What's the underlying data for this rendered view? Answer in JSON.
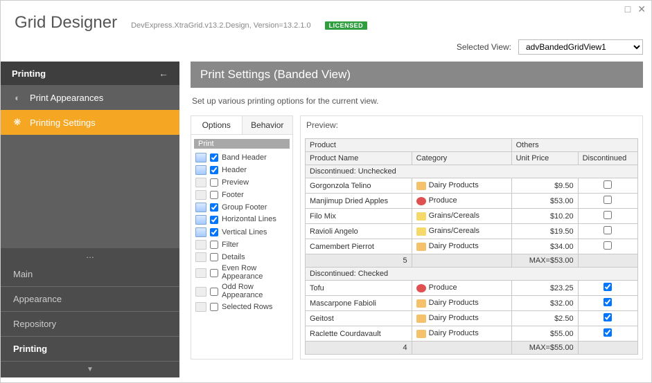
{
  "header": {
    "title": "Grid Designer",
    "subtitle": "DevExpress.XtraGrid.v13.2.Design, Version=13.2.1.0",
    "badge": "LICENSED"
  },
  "selected_view": {
    "label": "Selected View:",
    "value": "advBandedGridView1"
  },
  "sidebar": {
    "section": "Printing",
    "items": [
      {
        "label": "Print Appearances",
        "active": false
      },
      {
        "label": "Printing Settings",
        "active": true
      }
    ],
    "nav": [
      "Main",
      "Appearance",
      "Repository",
      "Printing"
    ],
    "nav_current": "Printing"
  },
  "content": {
    "title": "Print Settings (Banded View)",
    "subtitle": "Set up various printing options for the current view."
  },
  "options": {
    "tabs": [
      "Options",
      "Behavior"
    ],
    "active_tab": "Options",
    "group": "Print",
    "items": [
      {
        "label": "Band Header",
        "checked": true,
        "dim": false
      },
      {
        "label": "Header",
        "checked": true,
        "dim": false
      },
      {
        "label": "Preview",
        "checked": false,
        "dim": true
      },
      {
        "label": "Footer",
        "checked": false,
        "dim": true
      },
      {
        "label": "Group Footer",
        "checked": true,
        "dim": false
      },
      {
        "label": "Horizontal Lines",
        "checked": true,
        "dim": false
      },
      {
        "label": "Vertical Lines",
        "checked": true,
        "dim": false
      },
      {
        "label": "Filter",
        "checked": false,
        "dim": true
      },
      {
        "label": "Details",
        "checked": false,
        "dim": true
      },
      {
        "label": "Even Row Appearance",
        "checked": false,
        "dim": true
      },
      {
        "label": "Odd Row Appearance",
        "checked": false,
        "dim": true
      },
      {
        "label": "Selected Rows",
        "checked": false,
        "dim": true
      }
    ]
  },
  "preview": {
    "label": "Preview:",
    "bands": [
      "Product",
      "Others"
    ],
    "columns": [
      "Product Name",
      "Category",
      "Unit Price",
      "Discontinued"
    ],
    "groups": [
      {
        "header": "Discontinued: Unchecked",
        "rows": [
          {
            "name": "Gorgonzola Telino",
            "cat": "Dairy Products",
            "cat_icon": "dairy",
            "price": "$9.50",
            "disc": false
          },
          {
            "name": "Manjimup Dried Apples",
            "cat": "Produce",
            "cat_icon": "produce",
            "price": "$53.00",
            "disc": false
          },
          {
            "name": "Filo Mix",
            "cat": "Grains/Cereals",
            "cat_icon": "grains",
            "price": "$10.20",
            "disc": false
          },
          {
            "name": "Ravioli Angelo",
            "cat": "Grains/Cereals",
            "cat_icon": "grains",
            "price": "$19.50",
            "disc": false
          },
          {
            "name": "Camembert Pierrot",
            "cat": "Dairy Products",
            "cat_icon": "dairy",
            "price": "$34.00",
            "disc": false
          }
        ],
        "count": "5",
        "max": "MAX=$53.00"
      },
      {
        "header": "Discontinued: Checked",
        "rows": [
          {
            "name": "Tofu",
            "cat": "Produce",
            "cat_icon": "produce",
            "price": "$23.25",
            "disc": true
          },
          {
            "name": "Mascarpone Fabioli",
            "cat": "Dairy Products",
            "cat_icon": "dairy",
            "price": "$32.00",
            "disc": true
          },
          {
            "name": "Geitost",
            "cat": "Dairy Products",
            "cat_icon": "dairy",
            "price": "$2.50",
            "disc": true
          },
          {
            "name": "Raclette Courdavault",
            "cat": "Dairy Products",
            "cat_icon": "dairy",
            "price": "$55.00",
            "disc": true
          }
        ],
        "count": "4",
        "max": "MAX=$55.00"
      }
    ]
  }
}
